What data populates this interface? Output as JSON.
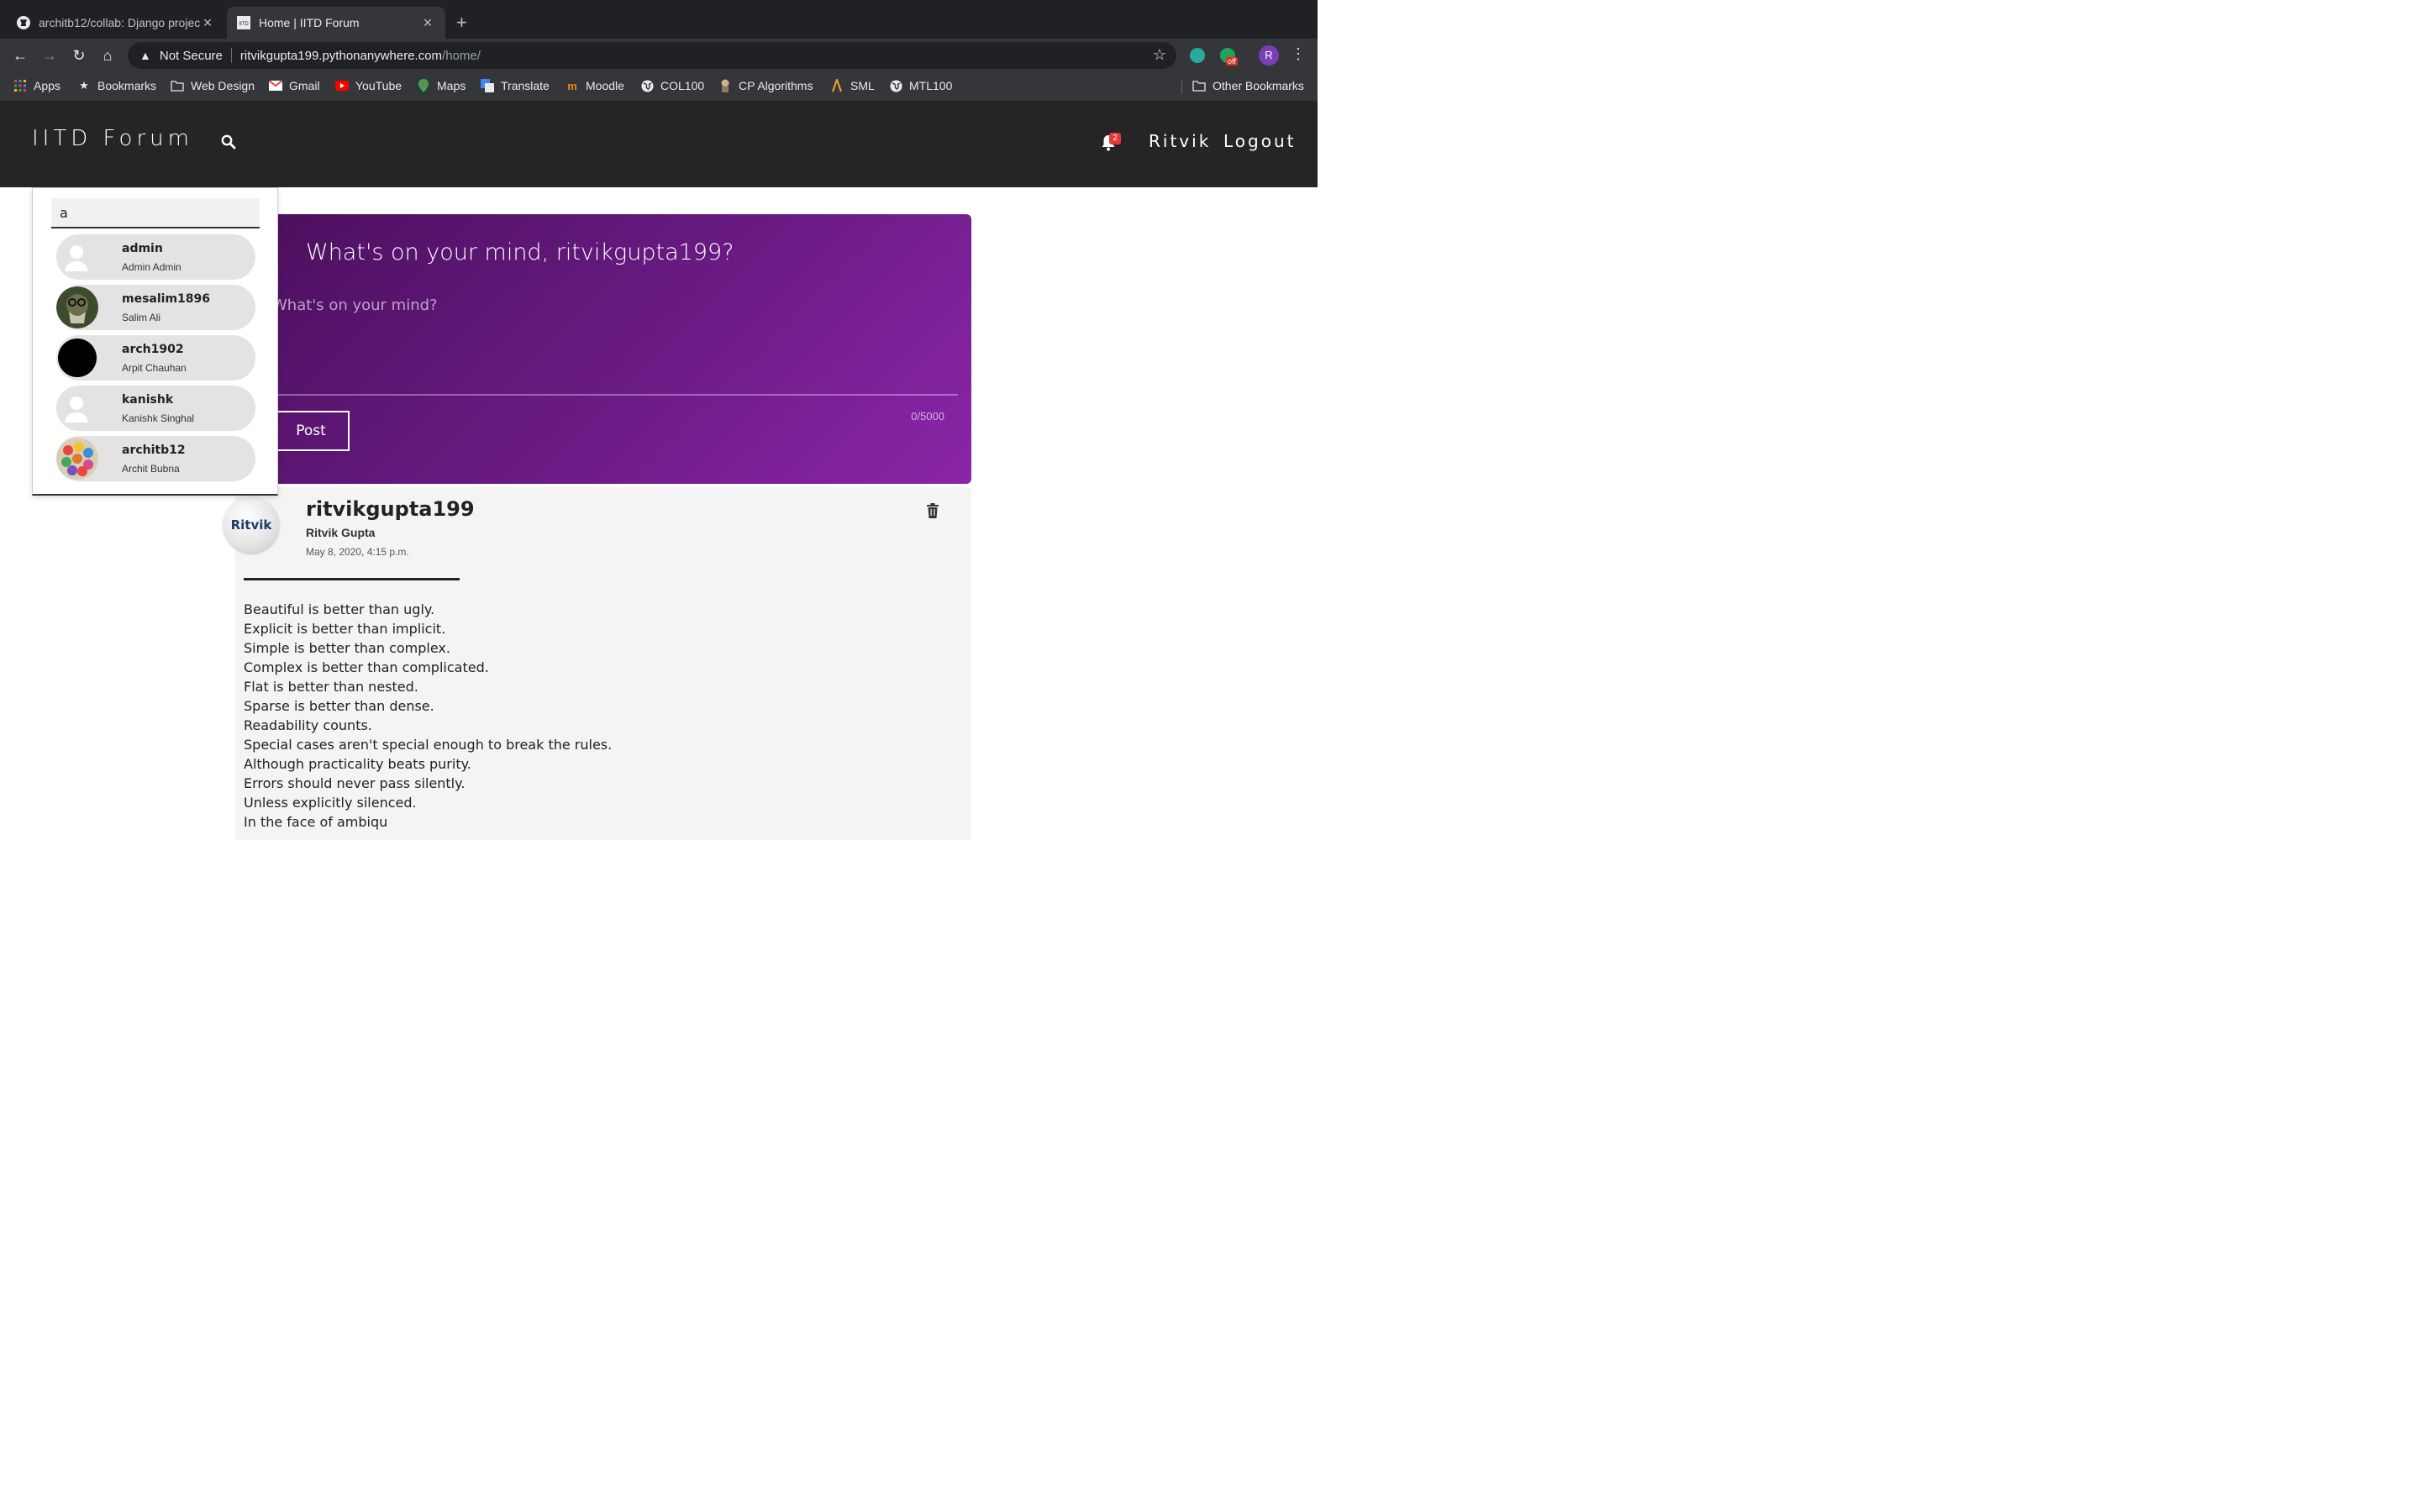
{
  "browser": {
    "tabs": [
      {
        "title": "architb12/collab: Django projec",
        "active": false
      },
      {
        "title": "Home | IITD Forum",
        "active": true
      }
    ],
    "url_security": "Not Secure",
    "url_host": "ritvikgupta199.pythonanywhere.com",
    "url_path": "/home/",
    "extension_badge": "off",
    "profile_initial": "R",
    "bookmarks": [
      "Apps",
      "Bookmarks",
      "Web Design",
      "Gmail",
      "YouTube",
      "Maps",
      "Translate",
      "Moodle",
      "COL100",
      "CP Algorithms",
      "SML",
      "MTL100"
    ],
    "other_bookmarks": "Other Bookmarks"
  },
  "header": {
    "brand": "IITD Forum",
    "notification_count": "2",
    "user_link": "Ritvik",
    "logout_link": "Logout"
  },
  "search": {
    "query": "a",
    "results": [
      {
        "username": "admin",
        "name": "Admin Admin",
        "avatar": "default"
      },
      {
        "username": "mesalim1896",
        "name": "Salim Ali",
        "avatar": "photo"
      },
      {
        "username": "arch1902",
        "name": "Arpit Chauhan",
        "avatar": "black"
      },
      {
        "username": "kanishk",
        "name": "Kanishk Singhal",
        "avatar": "default"
      },
      {
        "username": "architb12",
        "name": "Archit Bubna",
        "avatar": "colorful"
      }
    ]
  },
  "compose": {
    "heading": "What's on your mind, ritvikgupta199?",
    "placeholder": "What's on your mind?",
    "counter": "0/5000",
    "post_label": "Post"
  },
  "post": {
    "avatar_text": "Ritvik",
    "username": "ritvikgupta199",
    "fullname": "Ritvik Gupta",
    "date": "May 8, 2020, 4:15 p.m.",
    "lines": [
      "Beautiful is better than ugly.",
      "Explicit is better than implicit.",
      "Simple is better than complex.",
      "Complex is better than complicated.",
      "Flat is better than nested.",
      "Sparse is better than dense.",
      "Readability counts.",
      "Special cases aren't special enough to break the rules.",
      "Although practicality beats purity.",
      "Errors should never pass silently.",
      "Unless explicitly silenced.",
      "In the face of ambiqu"
    ]
  },
  "colors": {
    "header_bg": "#252525",
    "compose_gradient_start": "#4a0f5c",
    "compose_gradient_end": "#8c25a8",
    "badge_red": "#e53935"
  }
}
